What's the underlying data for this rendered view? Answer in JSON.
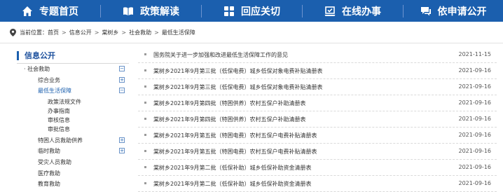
{
  "nav": {
    "items": [
      {
        "label": "专题首页",
        "icon": "home-icon"
      },
      {
        "label": "政策解读",
        "icon": "open-book-icon"
      },
      {
        "label": "回应关切",
        "icon": "grid-icon"
      },
      {
        "label": "在线办事",
        "icon": "laptop-check-icon"
      },
      {
        "label": "依申请公开",
        "icon": "chat-icon"
      }
    ]
  },
  "breadcrumb": {
    "prefix": "当前位置：",
    "items": [
      "首页",
      "信息公开",
      "棠树乡",
      "社会救助",
      "最低生活保障"
    ],
    "separator": ">"
  },
  "sidebar": {
    "title": "信息公开",
    "items": [
      {
        "label": "· 社会救助",
        "toggle": "−"
      },
      {
        "label": "综合业务",
        "toggle": "+"
      },
      {
        "label": "最低生活保障",
        "toggle": "−"
      },
      {
        "label": "政策法规文件"
      },
      {
        "label": "办事指南"
      },
      {
        "label": "审核信息"
      },
      {
        "label": "审批信息"
      },
      {
        "label": "特困人员救助供养",
        "toggle": "+"
      },
      {
        "label": "临时救助",
        "toggle": "+"
      },
      {
        "label": "受灾人员救助"
      },
      {
        "label": "医疗救助"
      },
      {
        "label": "教育救助"
      }
    ]
  },
  "articles": [
    {
      "title": "国务院关于进一步加强和改进最低生活保障工作的意见",
      "date": "2021-11-15"
    },
    {
      "title": "棠树乡2021年9月第三批（低保电费）城乡低保对象电费补贴清册表",
      "date": "2021-09-16"
    },
    {
      "title": "棠树乡2021年9月第三批（低保电费）城乡低保对象电费补贴清册表",
      "date": "2021-09-16"
    },
    {
      "title": "棠树乡2021年9月第四批（特困供养）农村五保户补助清册表",
      "date": "2021-09-16"
    },
    {
      "title": "棠树乡2021年9月第四批（特困供养）农村五保户补助清册表",
      "date": "2021-09-16"
    },
    {
      "title": "棠树乡2021年9月第五批（特困电费）农村五保户电费补贴清册表",
      "date": "2021-09-16"
    },
    {
      "title": "棠树乡2021年9月第五批（特困电费）农村五保户电费补贴清册表",
      "date": "2021-09-16"
    },
    {
      "title": "棠树乡2021年9月第二批（低保补助）城乡低保补助资金清册表",
      "date": "2021-09-16"
    },
    {
      "title": "棠树乡2021年9月第二批（低保补助）城乡低保补助资金清册表",
      "date": "2021-09-16"
    }
  ]
}
